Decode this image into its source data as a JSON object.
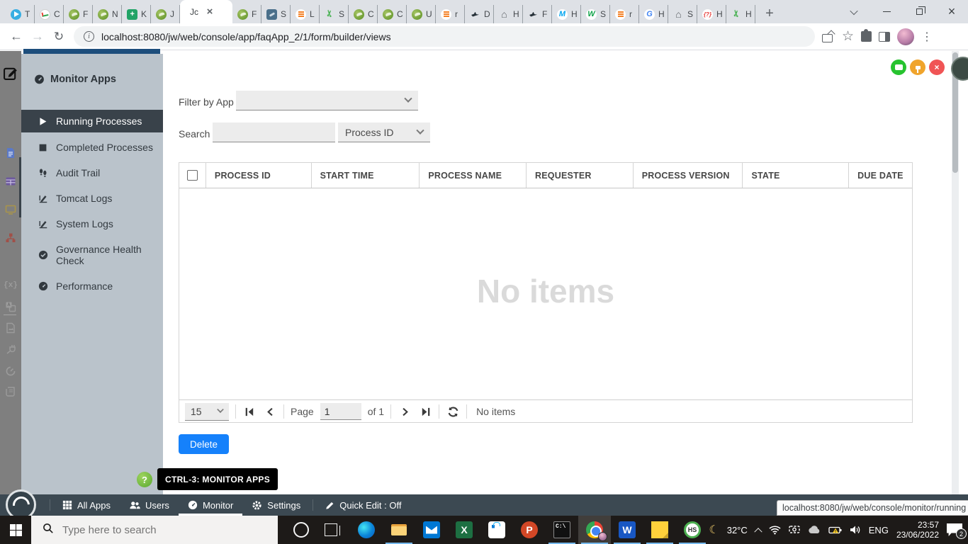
{
  "colors": {
    "accent_blue": "#1581fb",
    "sidebar_bg": "#bac3cb",
    "sidebar_active": "#39424a",
    "admin_bar": "#3c4952",
    "tooltip_green": "#6db544",
    "float_green": "#27c32f",
    "float_amber": "#f0a42c",
    "float_red": "#f05455"
  },
  "browser": {
    "url": "localhost:8080/jw/web/console/app/faqApp_2/1/form/builder/views",
    "tabs": [
      {
        "icon": "telegram-favicon",
        "label": "T"
      },
      {
        "icon": "chart-favicon",
        "label": "C"
      },
      {
        "icon": "joget-favicon",
        "label": "F"
      },
      {
        "icon": "joget-favicon",
        "label": "N"
      },
      {
        "icon": "sheet-favicon",
        "label": "K"
      },
      {
        "icon": "joget-favicon",
        "label": "J"
      },
      {
        "icon": "joget-favicon",
        "label": "Jc",
        "active": true
      },
      {
        "icon": "joget-favicon",
        "label": "F"
      },
      {
        "icon": "slate-favicon",
        "label": "S"
      },
      {
        "icon": "stackoverflow-favicon",
        "label": "L"
      },
      {
        "icon": "scissors-favicon",
        "label": "S"
      },
      {
        "icon": "joget-favicon",
        "label": "C"
      },
      {
        "icon": "joget-favicon",
        "label": "C"
      },
      {
        "icon": "joget-favicon",
        "label": "U"
      },
      {
        "icon": "stackoverflow-favicon",
        "label": "r"
      },
      {
        "icon": "bird-favicon",
        "label": "D"
      },
      {
        "icon": "home-favicon",
        "label": "H"
      },
      {
        "icon": "bird-favicon",
        "label": "F"
      },
      {
        "icon": "m-favicon",
        "label": "H"
      },
      {
        "icon": "w3-favicon",
        "label": "S"
      },
      {
        "icon": "stackoverflow-favicon",
        "label": "r"
      },
      {
        "icon": "google-favicon",
        "label": "H"
      },
      {
        "icon": "home-favicon",
        "label": "S"
      },
      {
        "icon": "qmark-favicon",
        "label": "H"
      },
      {
        "icon": "scissors-favicon",
        "label": "H"
      }
    ]
  },
  "sidebar": {
    "title": "Monitor Apps",
    "items": [
      {
        "label": "Running Processes",
        "active": true
      },
      {
        "label": "Completed Processes"
      },
      {
        "label": "Audit Trail"
      },
      {
        "label": "Tomcat Logs"
      },
      {
        "label": "System Logs"
      },
      {
        "label": "Governance Health Check"
      },
      {
        "label": "Performance"
      }
    ]
  },
  "content": {
    "filter_label": "Filter by App",
    "filter_value": "",
    "search_label": "Search",
    "search_value": "",
    "search_field": "Process ID",
    "columns": [
      "PROCESS ID",
      "START TIME",
      "PROCESS NAME",
      "REQUESTER",
      "PROCESS VERSION",
      "STATE",
      "DUE DATE"
    ],
    "empty_text": "No items",
    "pagination": {
      "page_size": "15",
      "page_label": "Page",
      "page_value": "1",
      "of_label": "of 1",
      "status": "No items"
    },
    "delete_label": "Delete"
  },
  "tooltip": {
    "help": "?",
    "text": "CTRL-3: MONITOR APPS"
  },
  "admin_bar": {
    "items": [
      {
        "label": "All Apps"
      },
      {
        "label": "Users"
      },
      {
        "label": "Monitor",
        "active": true
      },
      {
        "label": "Settings"
      }
    ],
    "quick_edit": "Quick Edit : Off"
  },
  "status_bubble": {
    "url": "localhost:8080/jw/web/console/monitor/running"
  },
  "taskbar": {
    "search_placeholder": "Type here to search",
    "temperature": "32°C",
    "language": "ENG",
    "time": "23:57",
    "date": "23/06/2022",
    "notifications": "2"
  }
}
